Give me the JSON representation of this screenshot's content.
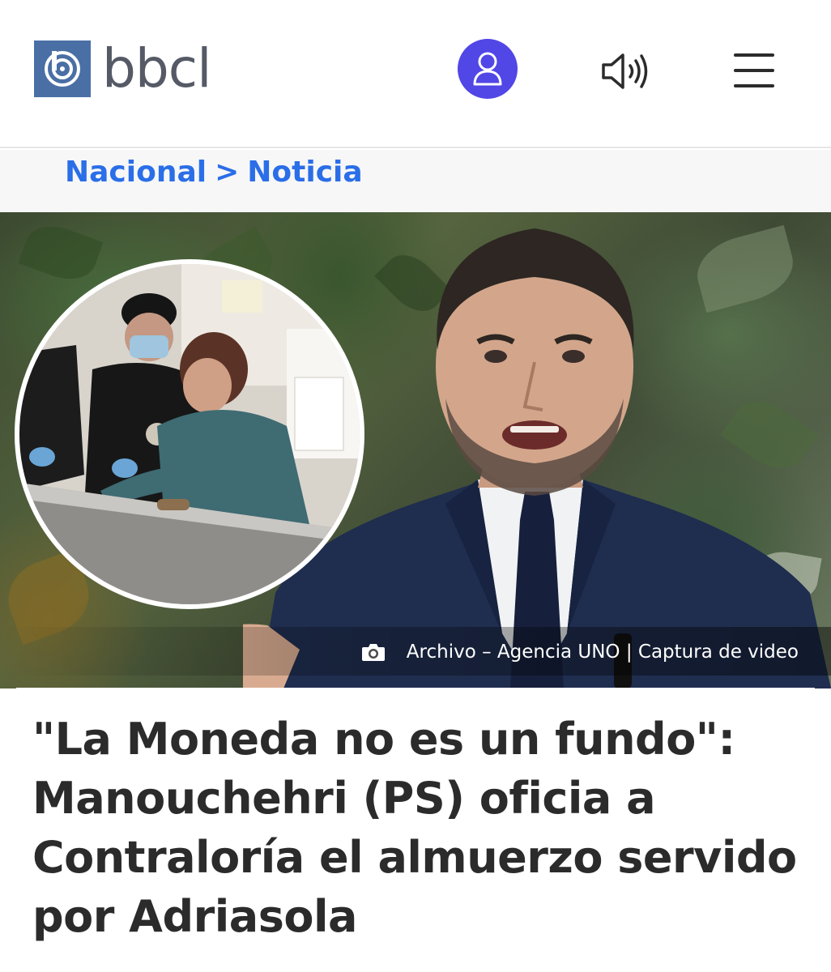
{
  "header": {
    "logo_text": "bbcl",
    "logo_icon": "bbcl-logo-icon",
    "user_icon": "user-icon",
    "audio_icon": "speaker-icon",
    "menu_icon": "hamburger-menu-icon",
    "accent_color": "#5146e6",
    "logo_color": "#4a6fa5"
  },
  "breadcrumb": {
    "section": "Nacional",
    "separator": ">",
    "page": "Noticia",
    "color": "#2a6ee8"
  },
  "hero": {
    "caption_icon": "camera-icon",
    "caption": "Archivo – Agencia UNO | Captura de video"
  },
  "article": {
    "headline": "\"La Moneda no es un fundo\": Manouchehri (PS) oficia a Contraloría el almuerzo servido por Adriasola"
  }
}
